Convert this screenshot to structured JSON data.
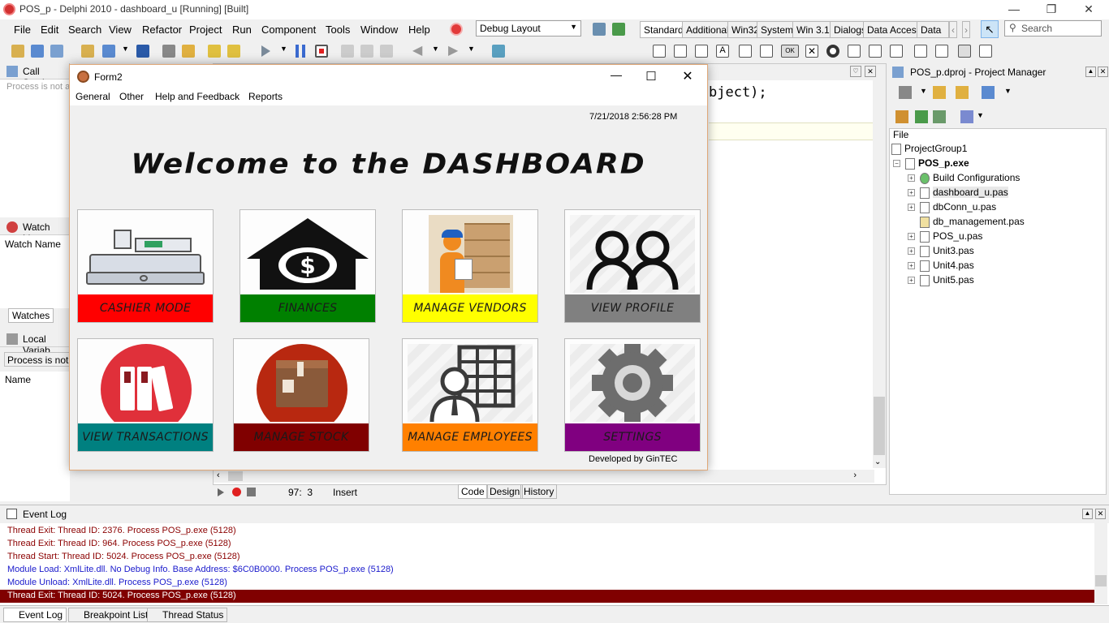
{
  "ide": {
    "title": "POS_p - Delphi 2010 - dashboard_u [Running] [Built]",
    "menu": [
      "File",
      "Edit",
      "Search",
      "View",
      "Refactor",
      "Project",
      "Run",
      "Component",
      "Tools",
      "Window",
      "Help"
    ],
    "layout_combo": "Debug Layout",
    "palette_tabs": [
      "Standard",
      "Additional",
      "Win32",
      "System",
      "Win 3.1",
      "Dialogs",
      "Data Access",
      "Data C"
    ],
    "search_placeholder": "Search",
    "left": {
      "call_stack": "Call Stack",
      "process_not_text": "Process is not a",
      "watch_list": "Watch List",
      "watch_name_col": "Watch Name",
      "watches_tab": "Watches",
      "local_variables": "Local Variab",
      "process_not_text2": "Process is not a",
      "name_col": "Name"
    },
    "editor": {
      "code_fragment": "bject);",
      "cursor_pos": "97:  3",
      "mode": "Insert",
      "tabs": [
        "Code",
        "Design",
        "History"
      ]
    },
    "project_manager": {
      "title": "POS_p.dproj - Project Manager",
      "file_col": "File",
      "group": "ProjectGroup1",
      "project": "POS_p.exe",
      "items": [
        "Build Configurations",
        "dashboard_u.pas",
        "dbConn_u.pas",
        "db_management.pas",
        "POS_u.pas",
        "Unit3.pas",
        "Unit4.pas",
        "Unit5.pas"
      ]
    },
    "event_log": {
      "title": "Event Log",
      "lines": [
        "Thread Exit: Thread ID: 2376. Process POS_p.exe (5128)",
        "Thread Exit: Thread ID: 964. Process POS_p.exe (5128)",
        "Thread Start: Thread ID: 5024. Process POS_p.exe (5128)",
        "Module Load: XmlLite.dll. No Debug Info. Base Address: $6C0B0000. Process POS_p.exe (5128)",
        "Module Unload: XmlLite.dll. Process POS_p.exe (5128)",
        "Thread Exit: Thread ID: 5024. Process POS_p.exe (5128)"
      ],
      "line_colors": [
        "#8b0000",
        "#8b0000",
        "#8b0000",
        "#1a1acc",
        "#1a1acc",
        "#ffffff"
      ]
    },
    "bottom_tabs": [
      "Event Log",
      "Breakpoint List",
      "Thread Status"
    ]
  },
  "form2": {
    "title": "Form2",
    "menu": [
      "General",
      "Other",
      "Help and Feedback",
      "Reports"
    ],
    "datetime": "7/21/2018 2:56:28 PM",
    "heading": "Welcome to the DASHBOARD",
    "footer": "Developed by GinTEC",
    "tiles": [
      {
        "label": "CASHIER MODE",
        "color": "#ff0000",
        "text_color": "#1a1a1a",
        "icon": "cash-register-icon"
      },
      {
        "label": "FINANCES",
        "color": "#008000",
        "text_color": "#1a1a1a",
        "icon": "house-money-icon"
      },
      {
        "label": "MANAGE VENDORS",
        "color": "#ffff00",
        "text_color": "#1a1a1a",
        "icon": "vendor-boxes-icon"
      },
      {
        "label": "VIEW PROFILE",
        "color": "#808080",
        "text_color": "#1a1a1a",
        "icon": "users-icon"
      },
      {
        "label": "VIEW TRANSACTIONS",
        "color": "#008080",
        "text_color": "#1a1a1a",
        "icon": "binders-icon"
      },
      {
        "label": "MANAGE STOCK",
        "color": "#800000",
        "text_color": "#1a1a1a",
        "icon": "box-icon"
      },
      {
        "label": "MANAGE EMPLOYEES",
        "color": "#ff8000",
        "text_color": "#1a1a1a",
        "icon": "employee-table-icon"
      },
      {
        "label": "SETTINGS",
        "color": "#800080",
        "text_color": "#1a1a1a",
        "icon": "gear-icon"
      }
    ]
  }
}
